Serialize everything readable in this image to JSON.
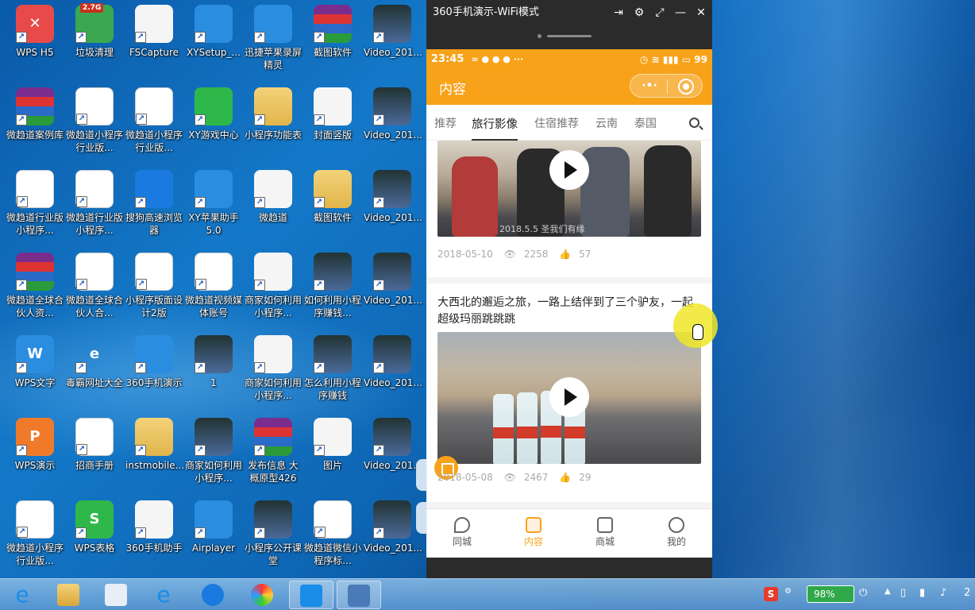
{
  "desktop": {
    "icons": [
      {
        "label": "WPS H5",
        "icon": "wps-h5-icon"
      },
      {
        "label": "垃圾清理",
        "icon": "trash-clean-icon",
        "badge": "2.7G"
      },
      {
        "label": "FSCapture",
        "icon": "fscapture-icon"
      },
      {
        "label": "XYSetup_...",
        "icon": "xysetup-icon"
      },
      {
        "label": "迅捷苹果录屏精灵",
        "icon": "screen-recorder-icon"
      },
      {
        "label": "截图软件",
        "icon": "archive-icon"
      },
      {
        "label": "Video_201...",
        "icon": "video-icon"
      },
      {
        "label": "微趋道案例库",
        "icon": "archive-icon"
      },
      {
        "label": "微趋道小程序行业版...",
        "icon": "pdf-icon"
      },
      {
        "label": "微趋道小程序行业版...",
        "icon": "excel-icon"
      },
      {
        "label": "XY游戏中心",
        "icon": "game-center-icon"
      },
      {
        "label": "小程序功能表",
        "icon": "doc-yellow-icon"
      },
      {
        "label": "封面竖版",
        "icon": "image-icon"
      },
      {
        "label": "Video_201...",
        "icon": "video-icon"
      },
      {
        "label": "微趋道行业版小程序...",
        "icon": "excel-icon"
      },
      {
        "label": "微趋道行业版小程序...",
        "icon": "excel-icon"
      },
      {
        "label": "搜狗高速浏览器",
        "icon": "sogou-browser-icon"
      },
      {
        "label": "XY苹果助手5.0",
        "icon": "xy-assistant-icon"
      },
      {
        "label": "微趋道",
        "icon": "image-icon"
      },
      {
        "label": "截图软件",
        "icon": "folder-icon"
      },
      {
        "label": "Video_201...",
        "icon": "video-icon"
      },
      {
        "label": "微趋道全球合伙人资...",
        "icon": "archive-icon"
      },
      {
        "label": "微趋道全球合伙人合...",
        "icon": "word-icon"
      },
      {
        "label": "小程序版面设计2版",
        "icon": "excel-icon"
      },
      {
        "label": "微趋道视频媒体账号",
        "icon": "excel-icon"
      },
      {
        "label": "商家如何利用小程序...",
        "icon": "image-icon"
      },
      {
        "label": "如何利用小程序赚钱...",
        "icon": "video-icon"
      },
      {
        "label": "Video_201...",
        "icon": "video-icon"
      },
      {
        "label": "WPS文字",
        "icon": "wps-writer-icon"
      },
      {
        "label": "毒霸网址大全",
        "icon": "ie-icon"
      },
      {
        "label": "360手机演示",
        "icon": "phone-demo-icon"
      },
      {
        "label": "1",
        "icon": "phone-video-icon"
      },
      {
        "label": "商家如何利用小程序...",
        "icon": "gear-doc-icon"
      },
      {
        "label": "怎么利用小程序赚钱",
        "icon": "video-icon"
      },
      {
        "label": "Video_201...",
        "icon": "video-icon"
      },
      {
        "label": "WPS演示",
        "icon": "wps-present-icon"
      },
      {
        "label": "招商手册",
        "icon": "pdf-icon"
      },
      {
        "label": "instmobile...",
        "icon": "installer-icon"
      },
      {
        "label": "商家如何利用小程序...",
        "icon": "video-icon"
      },
      {
        "label": "发布信息 大概原型426",
        "icon": "archive-icon"
      },
      {
        "label": "图片",
        "icon": "image-icon"
      },
      {
        "label": "Video_201...",
        "icon": "video-icon"
      },
      {
        "label": "微趋道小程序行业版...",
        "icon": "pdf-icon"
      },
      {
        "label": "WPS表格",
        "icon": "wps-sheet-icon"
      },
      {
        "label": "360手机助手",
        "icon": "phone-assistant-icon"
      },
      {
        "label": "Airplayer",
        "icon": "airplayer-icon"
      },
      {
        "label": "小程序公开课堂",
        "icon": "video-icon"
      },
      {
        "label": "微趋道微信小程序标...",
        "icon": "word-icon"
      },
      {
        "label": "Video_201...",
        "icon": "video-icon"
      }
    ]
  },
  "mirror": {
    "title": "360手机演示-WiFi模式",
    "status": {
      "time": "23:45",
      "left_icons": "∞ ● ● ● ···",
      "battery": "99"
    },
    "app": {
      "title": "内容",
      "tabs": [
        "推荐",
        "旅行影像",
        "住宿推荐",
        "云南",
        "泰国"
      ],
      "active_tab": "旅行影像",
      "posts": [
        {
          "caption": "2018.5.5 圣我们有缘",
          "date": "2018-05-10",
          "views": "2258",
          "likes": "57"
        },
        {
          "title": "大西北的邂逅之旅，一路上结伴到了三个驴友，一起超级玛丽跳跳跳",
          "date": "2018-05-08",
          "views": "2467",
          "likes": "29"
        }
      ],
      "tabbar": [
        {
          "label": "同城",
          "icon": "location-icon"
        },
        {
          "label": "内容",
          "icon": "content-icon"
        },
        {
          "label": "商城",
          "icon": "shop-bag-icon"
        },
        {
          "label": "我的",
          "icon": "user-icon"
        }
      ],
      "accent": "#f8a21a"
    }
  },
  "taskbar": {
    "battery": "98%"
  }
}
